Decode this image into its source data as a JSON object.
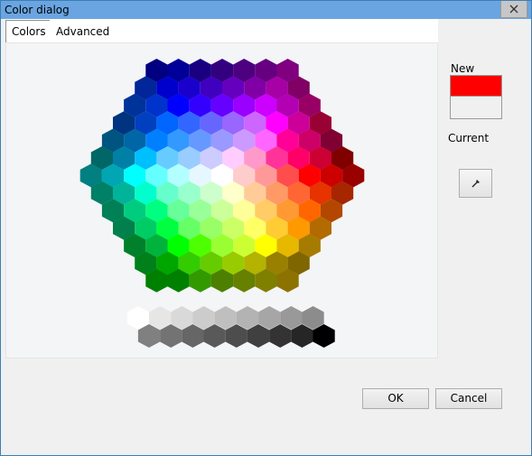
{
  "window": {
    "title": "Color dialog"
  },
  "tabs": [
    {
      "label": "Colors"
    },
    {
      "label": "Advanced"
    }
  ],
  "preview": {
    "new_label": "New",
    "current_label": "Current",
    "new_color": "#ff0000"
  },
  "buttons": {
    "ok": "OK",
    "cancel": "Cancel"
  },
  "colors": {
    "hexagon_rows": [
      [
        "#000080",
        "#000099",
        "#1a0080",
        "#330080",
        "#4d0080",
        "#660080",
        "#800080"
      ],
      [
        "#002699",
        "#0000cc",
        "#1a00cc",
        "#4000bf",
        "#6600bf",
        "#8000a6",
        "#a600a6",
        "#800066"
      ],
      [
        "#003399",
        "#0033cc",
        "#0000ff",
        "#3300ff",
        "#6600ff",
        "#9900ff",
        "#cc00ff",
        "#b300b3",
        "#990066"
      ],
      [
        "#003380",
        "#0040bf",
        "#0066ff",
        "#3366ff",
        "#6666ff",
        "#9966ff",
        "#cc66ff",
        "#ff00ff",
        "#cc0099",
        "#990033"
      ],
      [
        "#005580",
        "#0066a6",
        "#0080ff",
        "#3399ff",
        "#6699ff",
        "#9999ff",
        "#cc99ff",
        "#ff66ff",
        "#ff0099",
        "#cc0066",
        "#800033"
      ],
      [
        "#006666",
        "#0080a6",
        "#00bfff",
        "#66ccff",
        "#99ccff",
        "#ccccff",
        "#ffccff",
        "#ff99cc",
        "#ff3399",
        "#ff0066",
        "#cc0033",
        "#800000"
      ],
      [
        "#008080",
        "#00a6b3",
        "#00ffff",
        "#66ffff",
        "#b3ffff",
        "#e6f7ff",
        "#ffffff",
        "#ffcccc",
        "#ff9999",
        "#ff4d4d",
        "#ff0000",
        "#cc0000",
        "#990000"
      ],
      [
        "#008066",
        "#00b399",
        "#00ffcc",
        "#66ffcc",
        "#99ffcc",
        "#ccffcc",
        "#ffffcc",
        "#ffcc99",
        "#ff9966",
        "#ff6633",
        "#e63300",
        "#a62600"
      ],
      [
        "#008055",
        "#00cc80",
        "#00ff80",
        "#66ff99",
        "#99ff99",
        "#ccff99",
        "#ffff99",
        "#ffcc66",
        "#ff9933",
        "#ff6600",
        "#b34700"
      ],
      [
        "#00804d",
        "#00cc66",
        "#00ff40",
        "#66ff66",
        "#99ff66",
        "#ccff66",
        "#ffff66",
        "#ffcc33",
        "#ff9900",
        "#b36b00"
      ],
      [
        "#00802b",
        "#00b33c",
        "#00ff00",
        "#4dff00",
        "#99ff33",
        "#ccff33",
        "#ffff00",
        "#e6b800",
        "#a67c00"
      ],
      [
        "#00801a",
        "#00a600",
        "#33cc00",
        "#66cc00",
        "#99cc00",
        "#b3b300",
        "#998000",
        "#806600"
      ],
      [
        "#008000",
        "#008000",
        "#339900",
        "#4d8000",
        "#668000",
        "#808000",
        "#8c7300"
      ]
    ],
    "gray_row_1": [
      "#ffffff",
      "#e6e6e6",
      "#d9d9d9",
      "#cccccc",
      "#bfbfbf",
      "#b3b3b3",
      "#a6a6a6",
      "#999999",
      "#8c8c8c"
    ],
    "gray_row_2": [
      "#808080",
      "#737373",
      "#666666",
      "#595959",
      "#4d4d4d",
      "#404040",
      "#333333",
      "#262626",
      "#000000"
    ]
  }
}
